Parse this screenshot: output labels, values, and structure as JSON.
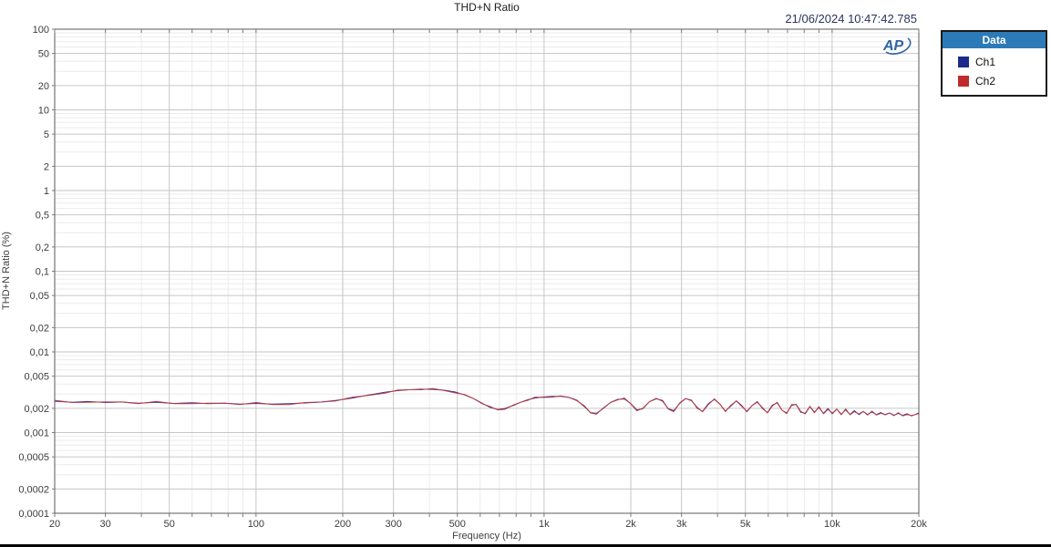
{
  "chart": {
    "title": "THD+N Ratio",
    "timestamp": "21/06/2024 10:47:42.785",
    "xlabel": "Frequency (Hz)",
    "ylabel": "THD+N Ratio (%)",
    "logo_text": "AP",
    "logo_color": "#2e64a5"
  },
  "legend": {
    "header": "Data",
    "items": [
      {
        "label": "Ch1",
        "color": "#1a2b8c"
      },
      {
        "label": "Ch2",
        "color": "#c02b2b"
      }
    ]
  },
  "colors": {
    "grid_major": "#c6c6c6",
    "grid_minor": "#ebebeb",
    "plot_border": "#5a5a5a",
    "tick": "#7a7a7a",
    "tick_label": "#3c3c3c"
  },
  "chart_data": {
    "type": "line",
    "title": "THD+N Ratio",
    "xlabel": "Frequency (Hz)",
    "ylabel": "THD+N Ratio (%)",
    "x_scale": "log",
    "y_scale": "log",
    "xlim": [
      20,
      20000
    ],
    "ylim": [
      0.0001,
      100
    ],
    "grid": true,
    "legend_position": "top-right-outside",
    "x_tick_values": [
      20,
      30,
      50,
      100,
      200,
      300,
      500,
      1000,
      2000,
      3000,
      5000,
      10000,
      20000
    ],
    "x_tick_labels": [
      "20",
      "30",
      "50",
      "100",
      "200",
      "300",
      "500",
      "1k",
      "2k",
      "3k",
      "5k",
      "10k",
      "20k"
    ],
    "y_tick_values": [
      100,
      50,
      20,
      10,
      5,
      2,
      1,
      0.5,
      0.2,
      0.1,
      0.05,
      0.02,
      0.01,
      0.005,
      0.002,
      0.001,
      0.0005,
      0.0002,
      0.0001
    ],
    "y_tick_labels": [
      "100",
      "50",
      "20",
      "10",
      "5",
      "2",
      "1",
      "0,5",
      "0,2",
      "0,1",
      "0,05",
      "0,02",
      "0,01",
      "0,005",
      "0,002",
      "0,001",
      "0,0005",
      "0,0002",
      "0,0001"
    ],
    "x_minor_values": [
      40,
      60,
      70,
      80,
      90,
      400,
      600,
      700,
      800,
      900,
      4000,
      6000,
      7000,
      8000,
      9000
    ],
    "y_minor_values": [
      30,
      40,
      60,
      70,
      80,
      90,
      3,
      4,
      6,
      7,
      8,
      9,
      0.3,
      0.4,
      0.6,
      0.7,
      0.8,
      0.9,
      0.03,
      0.04,
      0.06,
      0.07,
      0.08,
      0.09,
      0.003,
      0.004,
      0.006,
      0.007,
      0.008,
      0.009,
      0.0003,
      0.0004,
      0.0006,
      0.0007,
      0.0008,
      0.0009
    ],
    "x": [
      20,
      23,
      26,
      30,
      34,
      39,
      45,
      52,
      60,
      68,
      78,
      88,
      100,
      114,
      130,
      148,
      168,
      190,
      215,
      245,
      280,
      310,
      340,
      375,
      410,
      450,
      490,
      530,
      570,
      610,
      650,
      690,
      730,
      780,
      830,
      880,
      930,
      990,
      1060,
      1140,
      1220,
      1300,
      1380,
      1450,
      1520,
      1600,
      1700,
      1800,
      1900,
      2000,
      2100,
      2200,
      2320,
      2450,
      2580,
      2700,
      2820,
      2960,
      3100,
      3250,
      3400,
      3550,
      3720,
      3900,
      4080,
      4260,
      4450,
      4650,
      4850,
      5060,
      5280,
      5500,
      5730,
      5960,
      6200,
      6450,
      6700,
      6960,
      7230,
      7500,
      7780,
      8070,
      8370,
      8680,
      9000,
      9330,
      9670,
      10020,
      10380,
      10750,
      11140,
      11540,
      11950,
      12380,
      12820,
      13280,
      13750,
      14240,
      14750,
      15280,
      15820,
      16390,
      16970,
      17580,
      18210,
      18860,
      19400,
      20000
    ],
    "series": [
      {
        "name": "Ch1",
        "color": "#2b3a9e",
        "values": [
          0.00245,
          0.00238,
          0.00243,
          0.00236,
          0.0024,
          0.00232,
          0.00237,
          0.0023,
          0.00234,
          0.00228,
          0.00232,
          0.00226,
          0.0023,
          0.00225,
          0.00229,
          0.00233,
          0.00239,
          0.00251,
          0.00267,
          0.00291,
          0.00316,
          0.00331,
          0.0034,
          0.00345,
          0.00343,
          0.00335,
          0.00319,
          0.00293,
          0.00263,
          0.00231,
          0.00205,
          0.00193,
          0.00199,
          0.00216,
          0.00238,
          0.00256,
          0.00268,
          0.00276,
          0.00281,
          0.00281,
          0.00273,
          0.00252,
          0.0021,
          0.00177,
          0.00173,
          0.00197,
          0.00236,
          0.00258,
          0.00261,
          0.00229,
          0.00191,
          0.00197,
          0.00241,
          0.00266,
          0.00245,
          0.00197,
          0.00187,
          0.00231,
          0.00264,
          0.00252,
          0.00201,
          0.00183,
          0.00229,
          0.00258,
          0.00225,
          0.00185,
          0.00213,
          0.00248,
          0.00217,
          0.00181,
          0.00217,
          0.00242,
          0.00199,
          0.00177,
          0.00219,
          0.00234,
          0.00189,
          0.00175,
          0.00217,
          0.00224,
          0.00183,
          0.00171,
          0.00211,
          0.00179,
          0.00205,
          0.00173,
          0.00199,
          0.00171,
          0.00195,
          0.00169,
          0.00191,
          0.00168,
          0.00187,
          0.00167,
          0.00183,
          0.00168,
          0.0018,
          0.00167,
          0.00177,
          0.00166,
          0.00175,
          0.00164,
          0.00173,
          0.00163,
          0.00171,
          0.00161,
          0.00167,
          0.00175
        ]
      },
      {
        "name": "Ch2",
        "color": "#c03a3c",
        "values": [
          0.00251,
          0.00236,
          0.00237,
          0.0024,
          0.0024,
          0.00229,
          0.00243,
          0.00228,
          0.00228,
          0.00231,
          0.00232,
          0.00223,
          0.00236,
          0.00223,
          0.00223,
          0.00236,
          0.00239,
          0.00247,
          0.00274,
          0.00288,
          0.00308,
          0.00336,
          0.0034,
          0.0034,
          0.00352,
          0.00332,
          0.00311,
          0.00297,
          0.00263,
          0.00228,
          0.0021,
          0.00191,
          0.00194,
          0.00219,
          0.00238,
          0.00252,
          0.00275,
          0.00273,
          0.00274,
          0.00285,
          0.00273,
          0.00248,
          0.00215,
          0.00175,
          0.00169,
          0.002,
          0.00236,
          0.00254,
          0.00268,
          0.00227,
          0.00186,
          0.002,
          0.00241,
          0.00262,
          0.00251,
          0.00195,
          0.00182,
          0.00234,
          0.00264,
          0.00248,
          0.00206,
          0.00181,
          0.00223,
          0.00262,
          0.00225,
          0.00182,
          0.00218,
          0.00246,
          0.00212,
          0.00184,
          0.00217,
          0.00238,
          0.00204,
          0.00175,
          0.00214,
          0.00238,
          0.00189,
          0.00172,
          0.00222,
          0.00222,
          0.00178,
          0.00174,
          0.00211,
          0.00176,
          0.0021,
          0.00171,
          0.00194,
          0.00174,
          0.00195,
          0.00166,
          0.00196,
          0.00166,
          0.00182,
          0.0017,
          0.00183,
          0.00165,
          0.00185,
          0.00165,
          0.00173,
          0.00168,
          0.00175,
          0.00162,
          0.00177,
          0.00161,
          0.00167,
          0.00163,
          0.00167,
          0.00172
        ]
      }
    ]
  }
}
